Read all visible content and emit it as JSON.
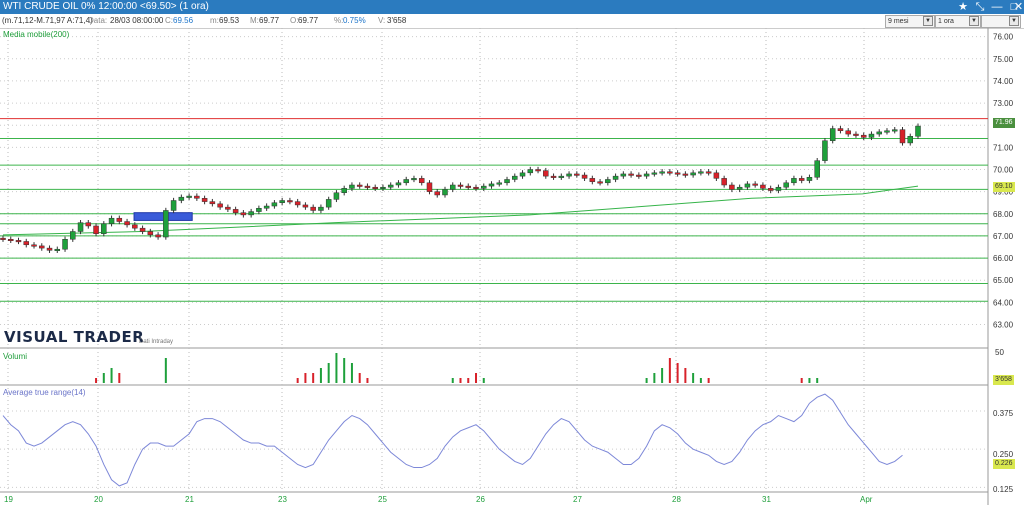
{
  "window": {
    "title": "WTI CRUDE OIL 0% 12:00:00  <69.50> (1 ora)",
    "icons": [
      "star-icon",
      "tool-icon",
      "minimize-icon",
      "maximize-icon",
      "close-icon"
    ]
  },
  "info_bar": {
    "range_text": "(m.71,12-M.71,97 A:71,4)",
    "date_label": "Data:",
    "date_value": "28/03 08:00:00",
    "close_label": "C:",
    "close_value": "69.56",
    "min_label": "m:",
    "min_value": "69.53",
    "max_label": "M:",
    "max_value": "69.77",
    "open_label": "O:",
    "open_value": "69.77",
    "pct_label": "%:",
    "pct_value": "0.75%",
    "vol_label": "V:",
    "vol_value": "3'658",
    "period_select": "9 mesi",
    "timeframe_select": "1 ora"
  },
  "brand": {
    "name": "VISUAL TRADER",
    "subtitle": "Dati Intraday"
  },
  "colors": {
    "bull": "#1ea03b",
    "bear": "#d8212a",
    "hline_green": "#3cb44b",
    "hline_red": "#e03030",
    "ma": "#36b44a",
    "atr": "#7d88d8",
    "highlight": "#3a5bd9",
    "titlebar": "#2b7bbf"
  },
  "chart_data": [
    {
      "type": "candlestick",
      "indicator_label": "Media mobile(200)",
      "y_ticks": [
        "76.00",
        "75.00",
        "74.00",
        "73.00",
        "72.00",
        "71.00",
        "70.00",
        "69.00",
        "68.00",
        "67.00",
        "66.00",
        "65.00",
        "64.00",
        "63.00"
      ],
      "ylim": [
        62.3,
        76.3
      ],
      "last_price_tag": "71.96",
      "ma_price_tag": "69.10",
      "horizontal_levels_green": [
        71.4,
        70.2,
        69.1,
        68.0,
        67.55,
        67.0,
        66.0,
        64.85,
        64.05
      ],
      "horizontal_level_red": 72.3,
      "moving_average": [
        [
          0,
          67.05
        ],
        [
          5,
          67.2
        ],
        [
          12,
          67.6
        ],
        [
          17,
          67.85
        ],
        [
          19,
          67.95
        ],
        [
          27,
          68.7
        ],
        [
          31,
          68.9
        ],
        [
          33,
          69.25
        ]
      ],
      "highlight_zone": {
        "x_start": 16.9,
        "x_end": 24.4,
        "y_low": 67.7,
        "y_high": 68.05
      },
      "closes": [
        66.85,
        66.8,
        66.75,
        66.6,
        66.55,
        66.45,
        66.35,
        66.4,
        66.85,
        67.2,
        67.6,
        67.45,
        67.1,
        67.55,
        67.8,
        67.65,
        67.5,
        67.35,
        67.2,
        67.05,
        66.95,
        68.15,
        68.6,
        68.75,
        68.8,
        68.7,
        68.55,
        68.45,
        68.3,
        68.2,
        68.05,
        67.95,
        68.1,
        68.25,
        68.35,
        68.5,
        68.6,
        68.55,
        68.4,
        68.3,
        68.15,
        68.3,
        68.65,
        68.95,
        69.15,
        69.3,
        69.25,
        69.2,
        69.15,
        69.2,
        69.3,
        69.4,
        69.55,
        69.6,
        69.4,
        69.0,
        68.85,
        69.1,
        69.3,
        69.25,
        69.2,
        69.15,
        69.25,
        69.35,
        69.4,
        69.55,
        69.7,
        69.85,
        70.0,
        69.95,
        69.7,
        69.65,
        69.7,
        69.8,
        69.75,
        69.6,
        69.45,
        69.4,
        69.55,
        69.7,
        69.8,
        69.75,
        69.7,
        69.8,
        69.85,
        69.9,
        69.85,
        69.8,
        69.75,
        69.85,
        69.9,
        69.85,
        69.6,
        69.3,
        69.1,
        69.2,
        69.35,
        69.3,
        69.15,
        69.05,
        69.2,
        69.4,
        69.6,
        69.5,
        69.65,
        70.4,
        71.3,
        71.85,
        71.75,
        71.6,
        71.55,
        71.45,
        71.6,
        71.7,
        71.75,
        71.8,
        71.2,
        71.5,
        71.96
      ]
    },
    {
      "type": "bar",
      "title": "Volumi",
      "y_ticks": [
        "50"
      ],
      "value_tag": "3'658",
      "values": [
        0,
        0,
        0,
        0,
        0,
        0,
        0,
        0,
        0,
        0,
        0,
        0,
        1,
        2,
        3,
        2,
        0,
        0,
        0,
        0,
        0,
        5,
        0,
        0,
        0,
        0,
        0,
        0,
        0,
        0,
        0,
        0,
        0,
        0,
        0,
        0,
        0,
        0,
        1,
        2,
        2,
        3,
        4,
        6,
        5,
        4,
        2,
        1,
        0,
        0,
        0,
        0,
        0,
        0,
        0,
        0,
        0,
        0,
        1,
        1,
        1,
        2,
        1,
        0,
        0,
        0,
        0,
        0,
        0,
        0,
        0,
        0,
        0,
        0,
        0,
        0,
        0,
        0,
        0,
        0,
        0,
        0,
        0,
        1,
        2,
        3,
        5,
        4,
        3,
        2,
        1,
        1,
        0,
        0,
        0,
        0,
        0,
        0,
        0,
        0,
        0,
        0,
        0,
        1,
        1,
        1,
        0,
        0,
        0,
        0,
        0,
        0,
        0,
        0,
        0,
        0,
        0,
        0,
        0
      ],
      "ylim": [
        0,
        55
      ]
    },
    {
      "type": "line",
      "title": "Average true range(14)",
      "y_ticks": [
        "0.375",
        "0.250",
        "0.125"
      ],
      "ylim": [
        0.11,
        0.45
      ],
      "value_tag": "0.226",
      "values": [
        0.36,
        0.33,
        0.31,
        0.27,
        0.26,
        0.27,
        0.29,
        0.31,
        0.33,
        0.34,
        0.33,
        0.3,
        0.26,
        0.2,
        0.15,
        0.13,
        0.14,
        0.2,
        0.25,
        0.27,
        0.27,
        0.26,
        0.26,
        0.28,
        0.3,
        0.34,
        0.35,
        0.35,
        0.34,
        0.32,
        0.3,
        0.28,
        0.27,
        0.27,
        0.26,
        0.26,
        0.24,
        0.22,
        0.2,
        0.19,
        0.2,
        0.24,
        0.28,
        0.31,
        0.34,
        0.36,
        0.35,
        0.33,
        0.3,
        0.27,
        0.24,
        0.22,
        0.2,
        0.19,
        0.19,
        0.2,
        0.22,
        0.26,
        0.29,
        0.31,
        0.32,
        0.33,
        0.31,
        0.28,
        0.25,
        0.23,
        0.21,
        0.2,
        0.22,
        0.26,
        0.3,
        0.33,
        0.35,
        0.34,
        0.31,
        0.28,
        0.26,
        0.25,
        0.24,
        0.22,
        0.2,
        0.2,
        0.22,
        0.26,
        0.31,
        0.33,
        0.32,
        0.3,
        0.27,
        0.25,
        0.24,
        0.23,
        0.21,
        0.2,
        0.21,
        0.24,
        0.28,
        0.31,
        0.33,
        0.34,
        0.36,
        0.35,
        0.34,
        0.36,
        0.4,
        0.42,
        0.43,
        0.41,
        0.37,
        0.33,
        0.3,
        0.27,
        0.24,
        0.21,
        0.2,
        0.21,
        0.23
      ]
    }
  ],
  "x_axis_dates": [
    "19",
    "20",
    "21",
    "23",
    "25",
    "26",
    "27",
    "28",
    "31",
    "Apr"
  ]
}
